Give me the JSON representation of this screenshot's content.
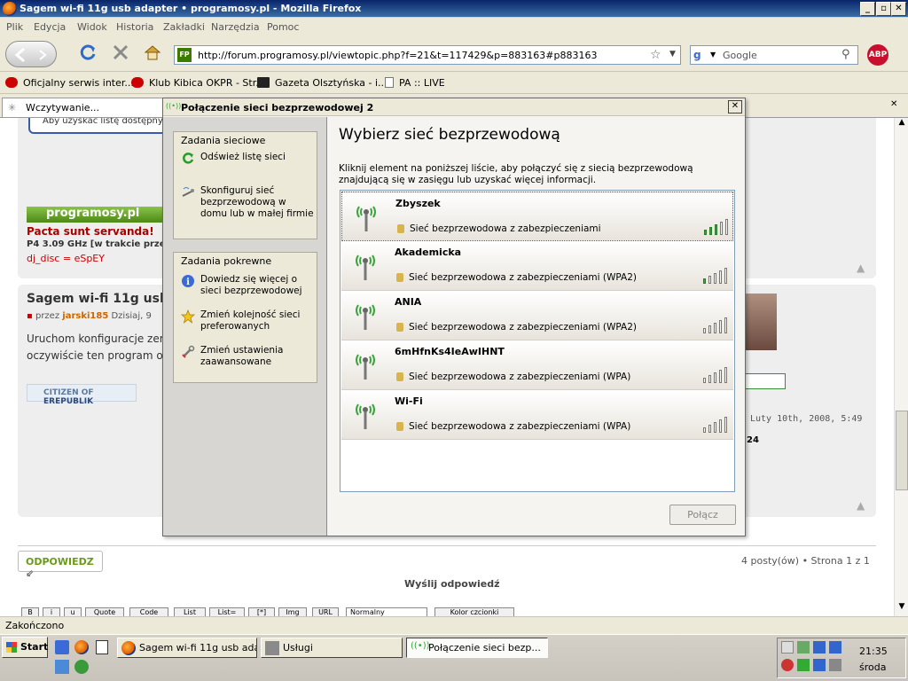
{
  "window": {
    "title": "Sagem wi-fi 11g usb adapter • programosy.pl - Mozilla Firefox"
  },
  "menu": [
    "Plik",
    "Edycja",
    "Widok",
    "Historia",
    "Zakładki",
    "Narzędzia",
    "Pomoc"
  ],
  "nav": {
    "url": "http://forum.programosy.pl/viewtopic.php?f=21&t=117429&p=883163#p883163",
    "search_placeholder": "Google",
    "adblock": "ABP"
  },
  "bookmarks": [
    "Oficjalny serwis inter...",
    "Klub Kibica OKPR - Str...",
    "Gazeta Olsztyńska - i...",
    "PA :: LIVE"
  ],
  "tab": {
    "label": "Wczytywanie..."
  },
  "page": {
    "notice": "Aby uzyskać listę dostępnych",
    "banner": "programosy.pl",
    "sig1": "Pacta sunt servanda!",
    "sig2": "P4 3.09 GHz [w trakcie przetak",
    "sig3": "dj_disc = eSpEY",
    "post_title": "Sagem wi-fi 11g usb a",
    "post_by": "przez",
    "post_author": "jarski185",
    "post_date": "Dzisiaj, 9",
    "post_body1": "Uruchom konfiguracje zer",
    "post_body2": "oczywiście ten program oc",
    "citizen": "CITIZEN OF",
    "erepublik": "EREPUBLIK",
    "date_right": "Luty 10th, 2008, 5:49",
    "num_right": "24",
    "reply_btn": "ODPOWIEDZ",
    "posts_count": "4 posty(ów) • Strona 1 z 1",
    "send_reply": "Wyślij odpowiedź",
    "editor_buttons": [
      "B",
      "i",
      "u",
      "Quote",
      "Code",
      "List",
      "List=",
      "[*]",
      "Img",
      "URL"
    ],
    "font_select": "Normalny",
    "font_color": "Kolor czcionki"
  },
  "status": {
    "text": "Zakończono"
  },
  "taskbar": {
    "start": "Start",
    "buttons": [
      "Sagem wi-fi 11g usb ada...",
      "Usługi",
      "Połączenie sieci bezp..."
    ],
    "clock": "21:35",
    "day": "środa"
  },
  "dialog": {
    "title": "Połączenie sieci bezprzewodowej 2",
    "close": "✕",
    "heading": "Wybierz sieć bezprzewodową",
    "instructions": "Kliknij element na poniższej liście, aby połączyć się z siecią bezprzewodową znajdującą się w zasięgu lub uzyskać więcej informacji.",
    "connect": "Połącz",
    "network_tasks": {
      "header": "Zadania sieciowe",
      "items": [
        "Odśwież listę sieci",
        "Skonfiguruj sieć bezprzewodową w domu lub w małej firmie"
      ]
    },
    "related_tasks": {
      "header": "Zadania pokrewne",
      "items": [
        "Dowiedz się więcej o sieci bezprzewodowej",
        "Zmień kolejność sieci preferowanych",
        "Zmień ustawienia zaawansowane"
      ]
    },
    "networks": [
      {
        "name": "Zbyszek",
        "security": "Sieć bezprzewodowa z zabezpieczeniami",
        "signal": 0.6
      },
      {
        "name": "Akademicka",
        "security": "Sieć bezprzewodowa z zabezpieczeniami (WPA2)",
        "signal": 0.2
      },
      {
        "name": "ANIA",
        "security": "Sieć bezprzewodowa z zabezpieczeniami (WPA2)",
        "signal": 0
      },
      {
        "name": "6mHfnKs4IeAwIHNT",
        "security": "Sieć bezprzewodowa z zabezpieczeniami (WPA)",
        "signal": 0
      },
      {
        "name": "Wi-Fi",
        "security": "Sieć bezprzewodowa z zabezpieczeniami (WPA)",
        "signal": 0
      }
    ]
  }
}
